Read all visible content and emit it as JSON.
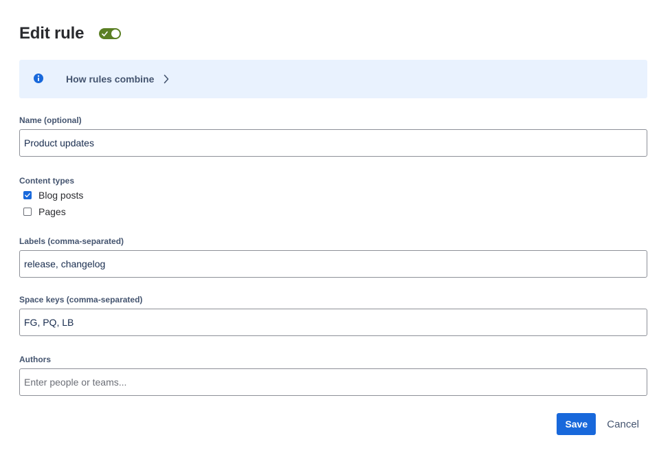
{
  "colors": {
    "accent_green": "#5b7f24",
    "info_bg": "#e9f2fe",
    "info_icon": "#1868db",
    "primary": "#1868db"
  },
  "header": {
    "title": "Edit rule",
    "enabled": true,
    "toggle_icon": "check-icon"
  },
  "banner": {
    "icon": "info-icon",
    "link_text": "How rules combine",
    "chevron_icon": "chevron-right-icon"
  },
  "form": {
    "name": {
      "label": "Name (optional)",
      "value": "Product updates"
    },
    "content_types": {
      "label": "Content types",
      "options": [
        {
          "label": "Blog posts",
          "checked": true
        },
        {
          "label": "Pages",
          "checked": false
        }
      ]
    },
    "labels": {
      "label": "Labels (comma-separated)",
      "value": "release, changelog"
    },
    "space_keys": {
      "label": "Space keys (comma-separated)",
      "value": "FG, PQ, LB"
    },
    "authors": {
      "label": "Authors",
      "value": "",
      "placeholder": "Enter people or teams..."
    }
  },
  "actions": {
    "save_label": "Save",
    "cancel_label": "Cancel"
  }
}
